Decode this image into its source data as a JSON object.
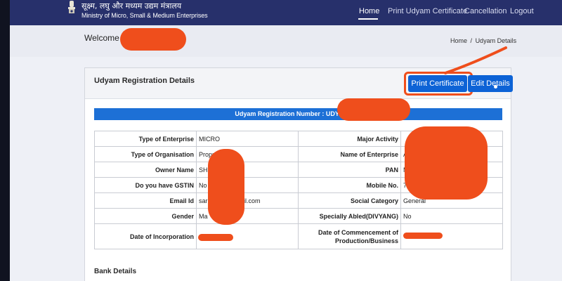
{
  "header": {
    "brand_hindi": "सूक्ष्म, लघु और मध्यम उद्यम मंत्रालय",
    "brand_english": "Ministry of Micro, Small & Medium Enterprises",
    "nav": [
      {
        "label": "Home",
        "active": true
      },
      {
        "label": "Print Udyam Certificate",
        "active": false
      },
      {
        "label": "Cancellation",
        "active": false
      },
      {
        "label": "Logout",
        "active": false
      }
    ]
  },
  "welcome": {
    "label": "Welcome : S"
  },
  "breadcrumb": {
    "home": "Home",
    "separator": "/",
    "current": "Udyam Details"
  },
  "card": {
    "title": "Udyam Registration Details",
    "print_button": "Print Certificate",
    "edit_button": "Edit Details",
    "registration_number_label": "Udyam Registration Number  :  UDYAM-UP-"
  },
  "details": {
    "rows": [
      {
        "left_label": "Type of Enterprise",
        "left_value": "MICRO",
        "right_label": "Major Activity",
        "right_value": ""
      },
      {
        "left_label": "Type of Organisation",
        "left_value": "Proprie",
        "right_label": "Name of Enterprise",
        "right_value": "A"
      },
      {
        "left_label": "Owner Name",
        "left_value": "SHR",
        "right_label": "PAN",
        "right_value": "M"
      },
      {
        "left_label": "Do you have GSTIN",
        "left_value": "No",
        "right_label": "Mobile No.",
        "right_value": "7"
      },
      {
        "left_label": "Email Id",
        "left_value": "sar",
        "left_value_tail": "gmail.com",
        "right_label": "Social Category",
        "right_value": "General"
      },
      {
        "left_label": "Gender",
        "left_value": "Ma",
        "right_label": "Specially Abled(DIVYANG)",
        "right_value": "No"
      },
      {
        "left_label": "Date of Incorporation",
        "left_value": "",
        "right_label": "Date of Commencement of Production/Business",
        "right_value": ""
      }
    ]
  },
  "bank": {
    "title": "Bank Details"
  },
  "colors": {
    "navbar": "#27306b",
    "accent_blue": "#1d70d6",
    "button_blue": "#0d63d6",
    "redaction_orange": "#ef4e1c"
  },
  "icons": [
    "national-emblem-icon"
  ]
}
